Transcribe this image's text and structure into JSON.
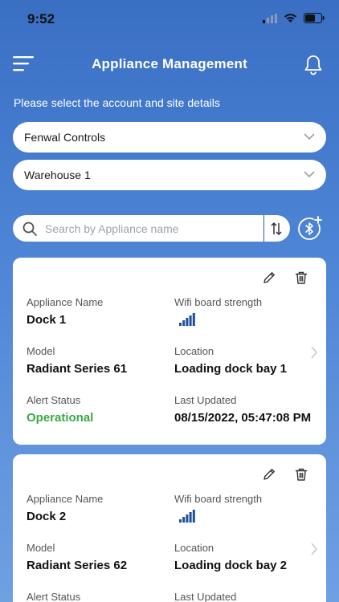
{
  "status_bar": {
    "time": "9:52"
  },
  "header": {
    "title": "Appliance Management"
  },
  "instructions": "Please select the account and site details",
  "account_select": {
    "value": "Fenwal Controls"
  },
  "site_select": {
    "value": "Warehouse 1"
  },
  "search": {
    "placeholder": "Search by Appliance name",
    "value": ""
  },
  "labels": {
    "name": "Appliance Name",
    "wifi": "Wifi board strength",
    "model": "Model",
    "location": "Location",
    "alert": "Alert Status",
    "updated": "Last Updated"
  },
  "appliances": [
    {
      "name": "Dock 1",
      "model": "Radiant Series 61",
      "location": "Loading dock bay 1",
      "alert_status": "Operational",
      "last_updated": "08/15/2022, 05:47:08 PM",
      "wifi_level": 1.0
    },
    {
      "name": "Dock 2",
      "model": "Radiant Series 62",
      "location": "Loading dock bay 2",
      "wifi_level": 1.0
    }
  ],
  "colors": {
    "accent": "#2a5fb5",
    "operational": "#3aa845",
    "wifi_bars": "#1f4f9a"
  }
}
